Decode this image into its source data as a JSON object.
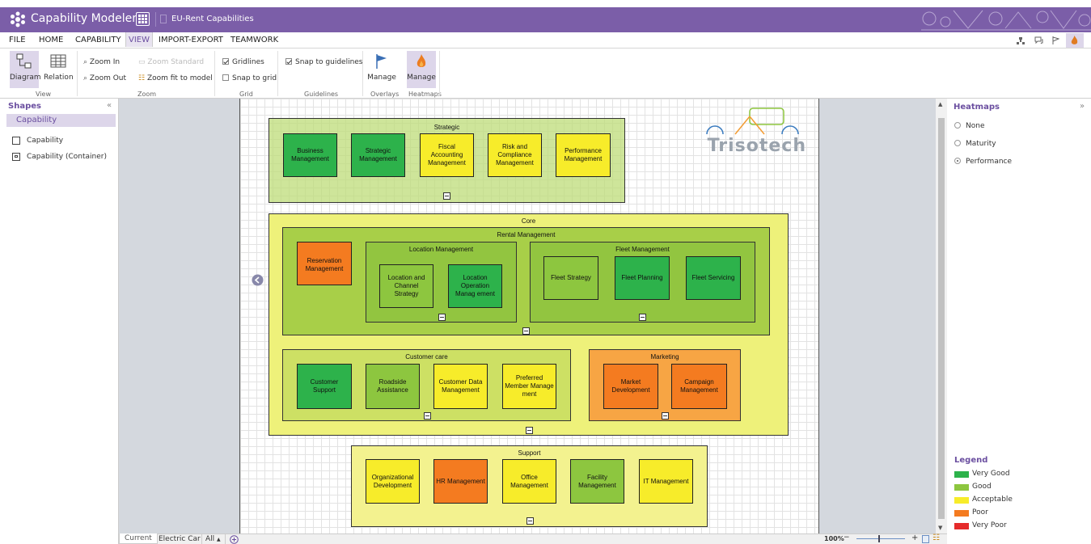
{
  "app": {
    "title": "Capability Modeler",
    "document": "EU-Rent Capabilities"
  },
  "menu": [
    "FILE",
    "HOME",
    "CAPABILITY",
    "VIEW",
    "IMPORT-EXPORT",
    "TEAMWORK"
  ],
  "ribbon": {
    "diagram": "Diagram",
    "relation": "Relation",
    "view_label": "View",
    "zoom_in": "Zoom In",
    "zoom_out": "Zoom Out",
    "zoom_standard": "Zoom Standard",
    "zoom_fit": "Zoom fit to model",
    "zoom_label": "Zoom",
    "gridlines": "Gridlines",
    "snap_grid": "Snap to grid",
    "grid_label": "Grid",
    "snap_guidelines": "Snap to guidelines",
    "guidelines_label": "Guidelines",
    "overlays_manage": "Manage",
    "overlays_label": "Overlays",
    "heatmaps_manage": "Manage",
    "heatmaps_label": "Heatmaps"
  },
  "shapes": {
    "title": "Shapes",
    "category": "Capability",
    "items": [
      "Capability",
      "Capability (Container)"
    ]
  },
  "diagram": {
    "logo": "Trisotech",
    "strategic": {
      "title": "Strategic",
      "items": [
        "Business Management",
        "Strategic Management",
        "Fiscal Accounting Management",
        "Risk and Compliance Management",
        "Performance Management"
      ]
    },
    "core": {
      "title": "Core"
    },
    "rental": {
      "title": "Rental Management",
      "reservation": "Reservation Management"
    },
    "location": {
      "title": "Location Management",
      "items": [
        "Location and Channel Strategy",
        "Location Operation Manag ement"
      ]
    },
    "fleet": {
      "title": "Fleet Management",
      "items": [
        "Fleet Strategy",
        "Fleet Planning",
        "Fleet Servicing"
      ]
    },
    "customer": {
      "title": "Customer care",
      "items": [
        "Customer Support",
        "Roadside Assistance",
        "Customer Data Management",
        "Preferred Member Manage ment"
      ]
    },
    "marketing": {
      "title": "Marketing",
      "items": [
        "Market Development",
        "Campaign Management"
      ]
    },
    "support": {
      "title": "Support",
      "items": [
        "Organizational Development",
        "HR Management",
        "Office Management",
        "Facility Management",
        "IT Management"
      ]
    }
  },
  "heatmaps": {
    "title": "Heatmaps",
    "options": [
      "None",
      "Maturity",
      "Performance"
    ],
    "selected": "Performance"
  },
  "legend": {
    "title": "Legend",
    "items": [
      {
        "label": "Very Good",
        "color": "#2db24b"
      },
      {
        "label": "Good",
        "color": "#8dc63f"
      },
      {
        "label": "Acceptable",
        "color": "#f7ec2a"
      },
      {
        "label": "Poor",
        "color": "#f47b20"
      },
      {
        "label": "Very Poor",
        "color": "#e52b2b"
      }
    ]
  },
  "bottom": {
    "tabs": [
      "Current",
      "Electric Car",
      "All"
    ],
    "zoom": "100%"
  }
}
